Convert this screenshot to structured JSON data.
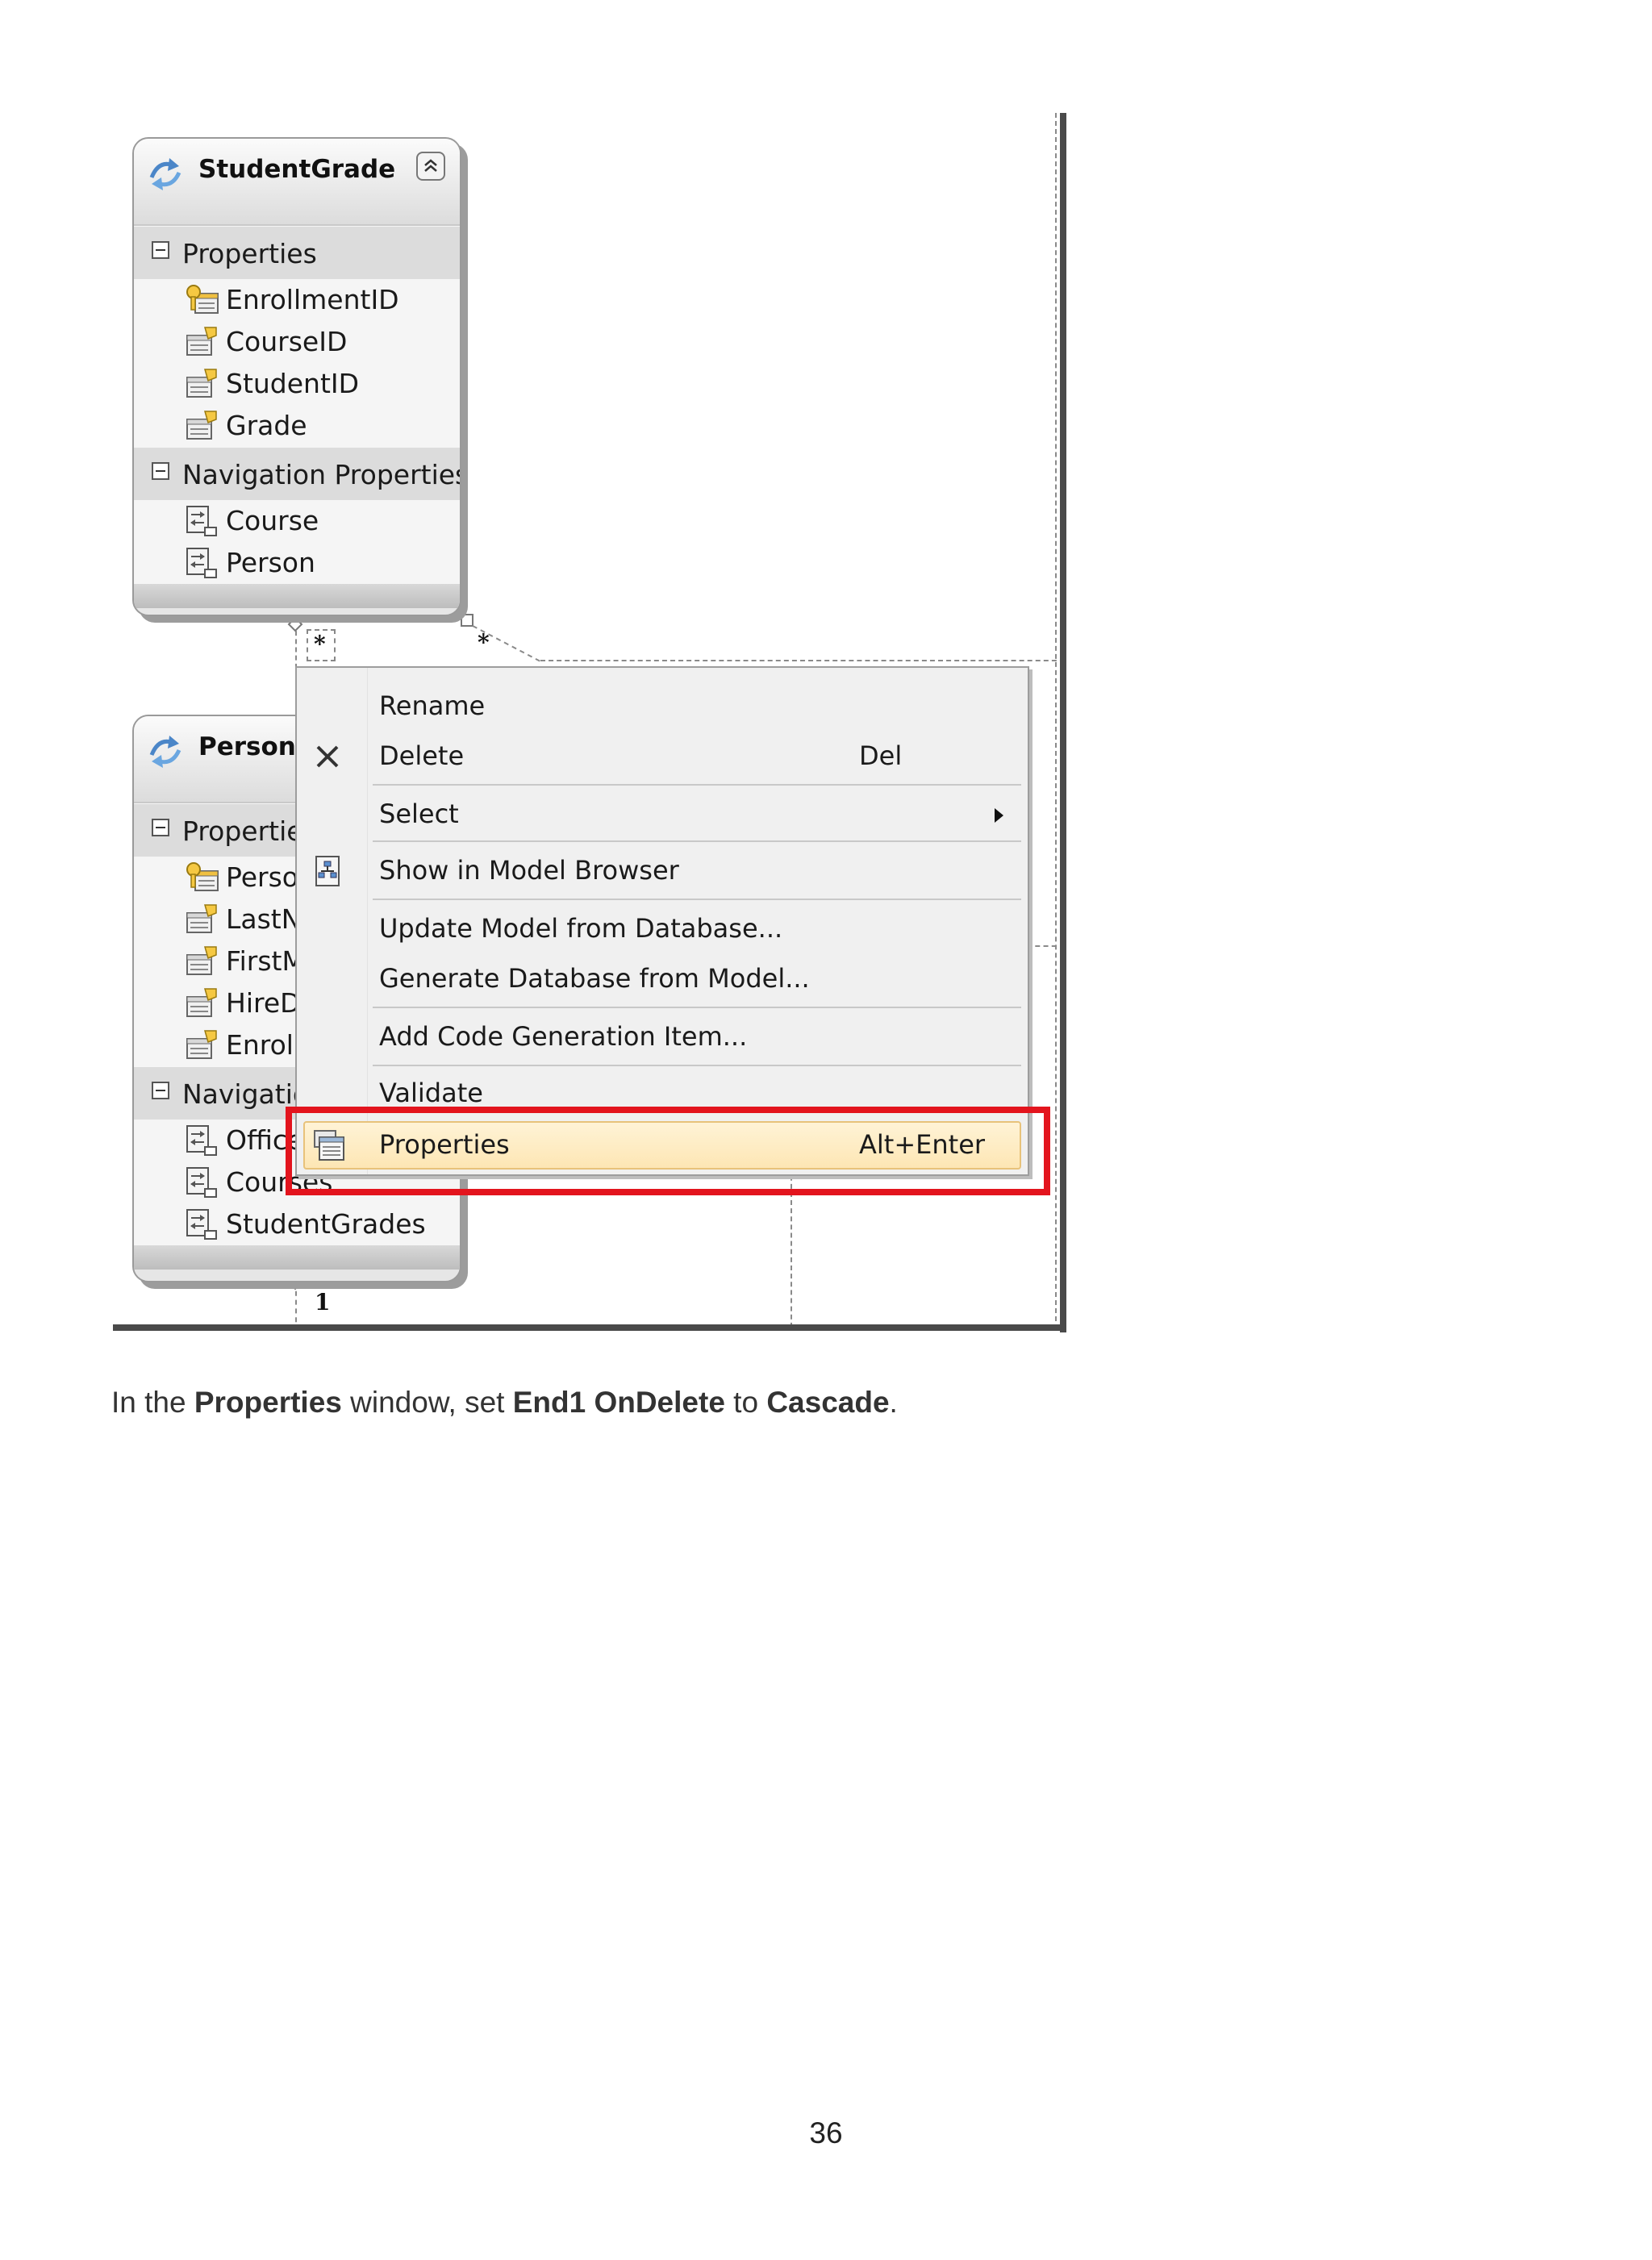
{
  "entities": {
    "student_grade": {
      "title": "StudentGrade",
      "sections": [
        {
          "label": "Properties",
          "items": [
            "EnrollmentID",
            "CourseID",
            "StudentID",
            "Grade"
          ]
        },
        {
          "label": "Navigation Properties",
          "items": [
            "Course",
            "Person"
          ]
        }
      ]
    },
    "person": {
      "title": "Person",
      "sections": [
        {
          "label": "Properties",
          "items": [
            "PersonID",
            "LastName",
            "FirstMidName",
            "HireDate",
            "EnrollmentDate"
          ]
        },
        {
          "label": "Navigation Properties",
          "items": [
            "OfficeAssignment",
            "Courses",
            "StudentGrades"
          ]
        }
      ]
    }
  },
  "connectors": {
    "many_left": "*",
    "many_right": "*",
    "one": "1"
  },
  "context_menu": {
    "items": [
      {
        "label": "Rename",
        "shortcut": "",
        "icon": ""
      },
      {
        "label": "Delete",
        "shortcut": "Del",
        "icon": "close-x-icon"
      },
      {
        "label": "Select",
        "shortcut": "",
        "icon": "",
        "submenu": true
      },
      {
        "label": "Show in Model Browser",
        "shortcut": "",
        "icon": "model-browser-icon"
      },
      {
        "label": "Update Model from Database...",
        "shortcut": "",
        "icon": ""
      },
      {
        "label": "Generate Database from Model...",
        "shortcut": "",
        "icon": ""
      },
      {
        "label": "Add Code Generation Item...",
        "shortcut": "",
        "icon": ""
      },
      {
        "label": "Validate",
        "shortcut": "",
        "icon": ""
      },
      {
        "label": "Properties",
        "shortcut": "Alt+Enter",
        "icon": "properties-window-icon",
        "highlighted": true
      }
    ]
  },
  "caption": {
    "t1": "In the ",
    "b1": "Properties",
    "t2": " window, set ",
    "b2": "End1 OnDelete",
    "t3": " to ",
    "b3": "Cascade",
    "t4": "."
  },
  "page_number": "36",
  "colors": {
    "highlight_outline": "#e3141d",
    "menu_highlight": "#fde6b4"
  }
}
